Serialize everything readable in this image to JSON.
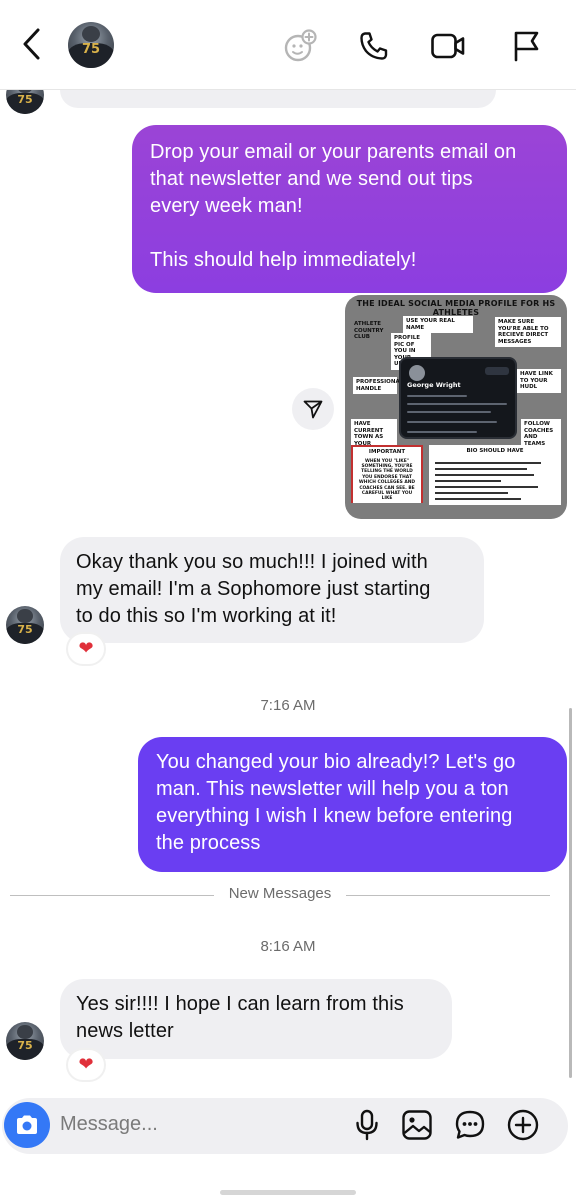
{
  "header": {
    "contact_avatar_number": "75"
  },
  "messages": [
    {
      "id": "out-1",
      "direction": "outgoing",
      "lines": [
        "Drop your email or your parents email on",
        "that newsletter and we send out tips",
        "every week man!",
        "",
        "This should help immediately!"
      ]
    },
    {
      "id": "out-image",
      "direction": "outgoing",
      "type": "image",
      "image": {
        "title": "THE IDEAL SOCIAL MEDIA PROFILE FOR HS ATHLETES",
        "brand": "ATHLETE COUNTRY CLUB",
        "labels": {
          "real_name": "USE YOUR REAL NAME",
          "profile_pic": "PROFILE PIC OF YOU IN YOUR UNIFORM",
          "direct_messages": "MAKE SURE YOU'RE ABLE TO RECIEVE DIRECT MESSAGES",
          "handle": "PROFESSIONAL HANDLE",
          "hudl": "HAVE LINK TO YOUR HUDL",
          "town": "HAVE CURRENT TOWN AS YOUR LOCATION",
          "follow": "FOLLOW COACHES AND TEAMS",
          "important_title": "IMPORTANT",
          "important_body": "WHEN YOU \"LIKE\" SOMETHING, YOU'RE TELLING THE WORLD YOU ENDORSE THAT WHICH COLLEGES AND COACHES CAN SEE. BE CAREFUL WHAT YOU LIKE",
          "bio_title": "BIO SHOULD HAVE"
        },
        "profile_name": "George Wright",
        "profile_handle": "@_George_Wright",
        "profile_follow": "Follow",
        "profile_bio": "Highland Park '22 | QB/SS | Midfield | 6'2\" 200 lbs | 4.55 40 | 4.36 GPA",
        "bio_items": [
          "HIGH SCHOOL (SPELL IT OUT)",
          "GPA (ACT/SAT SCORES ALSO GOOD)",
          "C/O (CLASS OF) 2022, 2023, ETC.",
          "YOUR POSITION",
          "OTHER SPORTS AND ORGANIZATIONS",
          "HEIGHT/WEIGHT",
          "LIMIT USE OF EMOJIS IN BIO",
          "RANKINGS FROM 247, RIVALS, ESPN, ETC."
        ]
      }
    },
    {
      "id": "in-1",
      "direction": "incoming",
      "lines": [
        "Okay thank you so much!!! I joined with",
        "my email! I'm a Sophomore just starting",
        "to do this so I'm working at it!"
      ],
      "reaction": "❤"
    },
    {
      "id": "time-1",
      "type": "timestamp",
      "text": "7:16 AM"
    },
    {
      "id": "out-2",
      "direction": "outgoing",
      "lines": [
        "You changed your bio already!? Let's go",
        "man. This newsletter will help you a ton",
        "everything I wish I knew before entering",
        "the process"
      ]
    },
    {
      "id": "divider",
      "type": "divider",
      "text": "New Messages"
    },
    {
      "id": "time-2",
      "type": "timestamp",
      "text": "8:16 AM"
    },
    {
      "id": "in-2",
      "direction": "incoming",
      "lines": [
        "Yes sir!!!! I hope I can learn from this",
        "news letter"
      ],
      "reaction": "❤"
    }
  ],
  "composer": {
    "placeholder": "Message..."
  },
  "colors": {
    "outgoing_1": "#9b44d6",
    "outgoing_2": "#6a3ef2",
    "incoming": "#efeff2",
    "camera": "#3478f6",
    "reaction": "#e0303a"
  },
  "icons": [
    "chevron-left-icon",
    "effects-icon",
    "phone-icon",
    "video-camera-icon",
    "flag-icon",
    "share-icon",
    "camera-icon",
    "microphone-icon",
    "gallery-icon",
    "sticker-chat-icon",
    "plus-circle-icon"
  ]
}
